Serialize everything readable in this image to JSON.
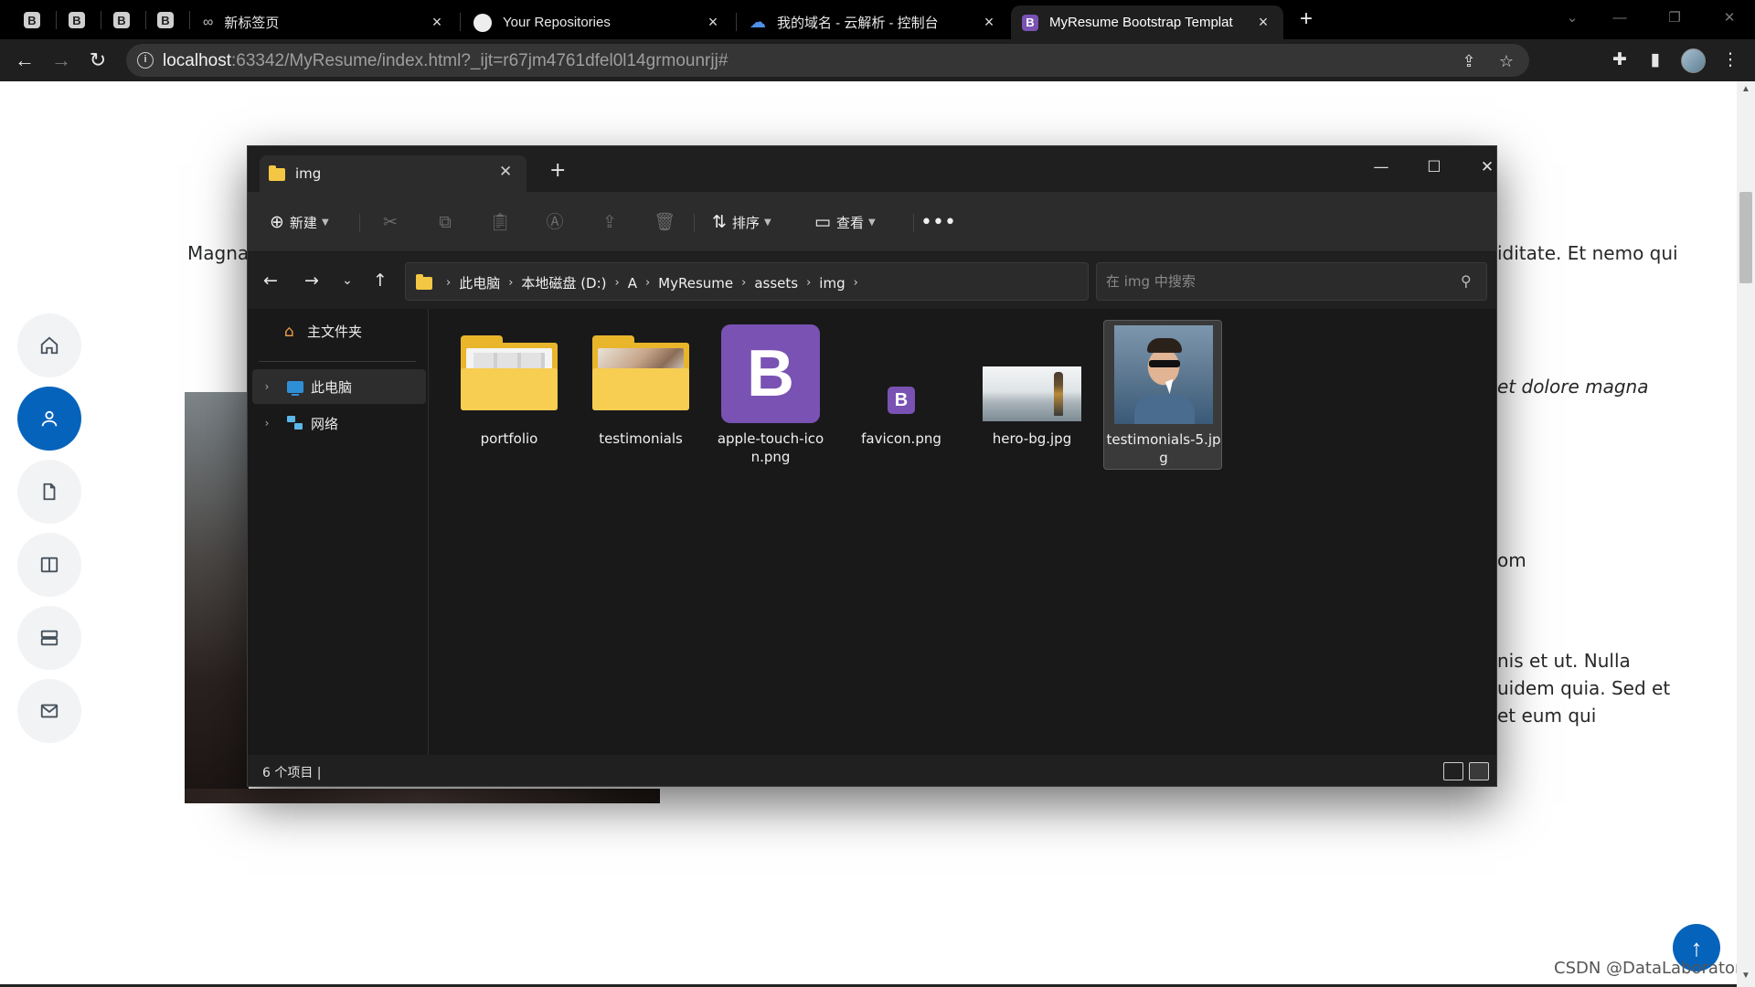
{
  "browser": {
    "tabs": [
      {
        "title": "新标签页"
      },
      {
        "title": "Your Repositories"
      },
      {
        "title": "我的域名 - 云解析 - 控制台"
      },
      {
        "title": "MyResume Bootstrap Templat"
      }
    ],
    "address": {
      "host": "localhost",
      "rest": ":63342/MyResume/index.html?_ijt=r67jm4761dfel0l14grmounrjj#"
    }
  },
  "page": {
    "text_lines": [
      "Magna",
      "iditate. Et nemo qui",
      "et dolore magna",
      "om",
      "nis et ut. Nulla",
      "uidem quia. Sed et",
      "et eum qui"
    ],
    "watermark": "CSDN @DataLaboratory"
  },
  "explorer": {
    "tab_title": "img",
    "commands": {
      "new": "新建",
      "sort": "排序",
      "view": "查看"
    },
    "breadcrumb": [
      "此电脑",
      "本地磁盘 (D:)",
      "A",
      "MyResume",
      "assets",
      "img"
    ],
    "search_placeholder": "在 img 中搜索",
    "nav": {
      "home": "主文件夹",
      "this_pc": "此电脑",
      "network": "网络"
    },
    "files": [
      {
        "name": "portfolio",
        "kind": "folder"
      },
      {
        "name": "testimonials",
        "kind": "folder"
      },
      {
        "name": "apple-touch-icon.png",
        "kind": "bootstrap-image"
      },
      {
        "name": "favicon.png",
        "kind": "bootstrap-image"
      },
      {
        "name": "hero-bg.jpg",
        "kind": "photo"
      },
      {
        "name": "testimonials-5.jpg",
        "kind": "photo",
        "selected": true
      }
    ],
    "status": "6 个项目 |"
  },
  "colors": {
    "accent": "#0563bb",
    "bootstrap_purple": "#7952b3",
    "folder_yellow": "#f7cd52"
  }
}
